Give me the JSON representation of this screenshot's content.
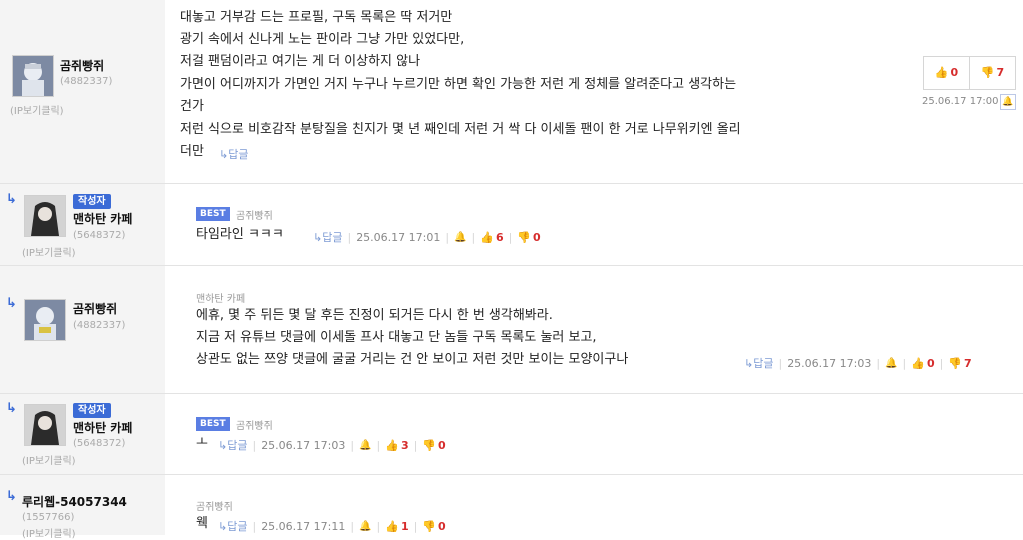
{
  "comments": [
    {
      "nick": "곰쥐빵쥐",
      "uid": "(4882337)",
      "ip": "(IP보기클릭)",
      "lines": [
        "대놓고 거부감 드는 프로필, 구독 목록은 딱 저거만",
        "광기 속에서 신나게 노는 판이라 그냥 가만 있었다만,",
        "저걸 팬덤이라고 여기는 게 더 이상하지 않나",
        "가면이 어디까지가 가면인 거지 누구나 누르기만 하면 확인 가능한 저런 게 정체를 알려준다고 생각하는",
        "건가",
        "저런 식으로 비호감작 분탕질을 친지가 몇 년 째인데 저런 거 싹 다 이세돌 팬이 한 거로 나무위키엔 올리",
        "더만"
      ],
      "reply": "↳답글",
      "up": "0",
      "down": "7",
      "date": "25.06.17 17:00"
    },
    {
      "badge": "작성자",
      "nick": "맨하탄 카페",
      "uid": "(5648372)",
      "ip": "(IP보기클릭)",
      "best": "BEST",
      "target": "곰쥐빵쥐",
      "text": "타임라인 ㅋㅋㅋ",
      "reply": "↳답글",
      "date": "25.06.17 17:01",
      "up": "6",
      "down": "0"
    },
    {
      "nick": "곰쥐빵쥐",
      "uid": "(4882337)",
      "target": "맨하탄 카페",
      "lines": [
        "에휴, 몇 주 뒤든 몇 달 후든 진정이 되거든 다시 한 번 생각해봐라.",
        "지금 저 유튜브 댓글에 이세돌 프사 대놓고 단 놈들 구독 목록도 눌러 보고,",
        "상관도 없는 쯔양 댓글에 굴굴 거리는 건 안 보이고 저런 것만 보이는 모양이구나"
      ],
      "reply": "↳답글",
      "date": "25.06.17 17:03",
      "up": "0",
      "down": "7"
    },
    {
      "badge": "작성자",
      "nick": "맨하탄 카페",
      "uid": "(5648372)",
      "ip": "(IP보기클릭)",
      "best": "BEST",
      "target": "곰쥐빵쥐",
      "text": "ㅗ",
      "reply": "↳답글",
      "date": "25.06.17 17:03",
      "up": "3",
      "down": "0"
    },
    {
      "nick": "루리웹-54057344",
      "uid": "(1557766)",
      "ip": "(IP보기클릭)",
      "target": "곰쥐빵쥐",
      "text": "웩",
      "reply": "↳답글",
      "date": "25.06.17 17:11",
      "up": "1",
      "down": "0"
    }
  ],
  "icons": {
    "reply_arrow": "↳",
    "thumb_up": "👍",
    "thumb_down": "👎",
    "bell": "🔔"
  },
  "colors": {
    "accent": "#3b6bd6",
    "count": "#d62c2c",
    "best": "#5a7ee3"
  }
}
